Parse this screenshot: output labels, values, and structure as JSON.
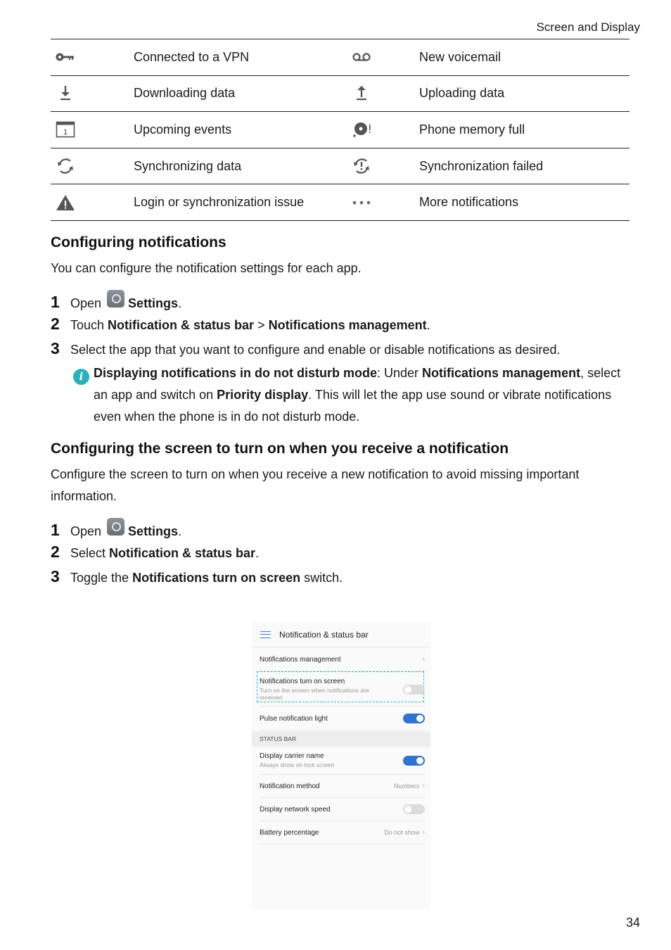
{
  "header": {
    "section": "Screen and Display"
  },
  "icon_table": {
    "rows": [
      {
        "left": {
          "icon": "vpn-key-icon",
          "label": "Connected to a VPN"
        },
        "right": {
          "icon": "voicemail-icon",
          "label": "New voicemail"
        }
      },
      {
        "left": {
          "icon": "download-icon",
          "label": "Downloading data"
        },
        "right": {
          "icon": "upload-icon",
          "label": "Uploading data"
        }
      },
      {
        "left": {
          "icon": "calendar-icon",
          "label": "Upcoming events"
        },
        "right": {
          "icon": "memory-full-icon",
          "label": "Phone memory full"
        }
      },
      {
        "left": {
          "icon": "sync-icon",
          "label": "Synchronizing data"
        },
        "right": {
          "icon": "sync-failed-icon",
          "label": "Synchronization failed"
        }
      },
      {
        "left": {
          "icon": "warning-icon",
          "label": "Login or synchronization issue"
        },
        "right": {
          "icon": "more-dots-icon",
          "label": "More notifications"
        }
      }
    ],
    "calendar_day": "1"
  },
  "section1": {
    "title": "Configuring notifications",
    "intro": "You can configure the notification settings for each app.",
    "steps": [
      {
        "num": "1",
        "pre": "Open",
        "bold": "Settings",
        "post": "."
      },
      {
        "num": "2",
        "pre": "Touch ",
        "bold": "Notification & status bar",
        "mid": " > ",
        "bold2": "Notifications management",
        "post": "."
      },
      {
        "num": "3",
        "text": "Select the app that you want to configure and enable or disable notifications as desired."
      }
    ],
    "note": {
      "icon": "info-icon",
      "bold1": "Displaying notifications in do not disturb mode",
      "t1": ": Under ",
      "bold2": "Notifications management",
      "t2": ", select an app and switch on ",
      "bold3": "Priority display",
      "t3": ". This will let the app use sound or vibrate notifications even when the phone is in do not disturb mode."
    }
  },
  "section2": {
    "title": "Configuring the screen to turn on when you receive a notification",
    "intro": "Configure the screen to turn on when you receive a new notification to avoid missing important information.",
    "steps": [
      {
        "num": "1",
        "pre": "Open",
        "bold": "Settings",
        "post": "."
      },
      {
        "num": "2",
        "pre": "Select ",
        "bold": "Notification & status bar",
        "post": "."
      },
      {
        "num": "3",
        "pre": "Toggle the ",
        "bold": "Notifications turn on screen",
        "post": " switch."
      }
    ]
  },
  "phone": {
    "title": "Notification & status bar",
    "rows": {
      "notifications_management": "Notifications management",
      "turn_on_screen": {
        "title": "Notifications turn on screen",
        "subtitle": "Turn on the screen when notifications are received",
        "enabled": false
      },
      "pulse_light": {
        "title": "Pulse notification light",
        "enabled": true
      },
      "section": "STATUS BAR",
      "carrier_name": {
        "title": "Display carrier name",
        "subtitle": "Always show on lock screen",
        "enabled": true
      },
      "notification_method": {
        "title": "Notification method",
        "value": "Numbers"
      },
      "network_speed": {
        "title": "Display network speed",
        "enabled": false
      },
      "battery": {
        "title": "Battery percentage",
        "value": "Do not show"
      }
    },
    "chevron": "›"
  },
  "footer": {
    "page_number": "34"
  }
}
